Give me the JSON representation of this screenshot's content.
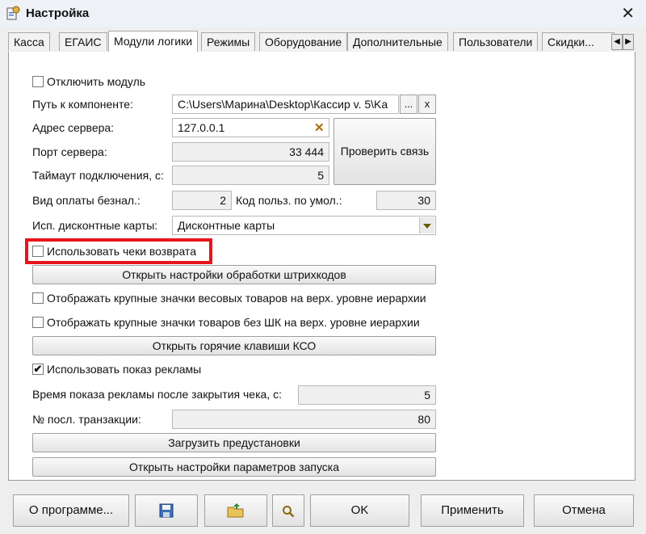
{
  "window": {
    "title": "Настройка"
  },
  "tabs": [
    "Касса",
    "ЕГАИС",
    "Модули логики",
    "Режимы",
    "Оборудование",
    "Дополнительные",
    "Пользователи",
    "Скидки..."
  ],
  "form": {
    "disable_module": {
      "label": "Отключить модуль",
      "checked": false
    },
    "component_path": {
      "label": "Путь к компоненте:",
      "value": "C:\\Users\\Марина\\Desktop\\Кассир v. 5\\Ka",
      "browse": "...",
      "clear": "x"
    },
    "server_address": {
      "label": "Адрес сервера:",
      "value": "127.0.0.1"
    },
    "server_port": {
      "label": "Порт сервера:",
      "value": "33 444"
    },
    "timeout": {
      "label": "Таймаут подключения, с:",
      "value": "5"
    },
    "check_connection": "Проверить связь",
    "cashless_payment": {
      "label": "Вид оплаты безнал.:",
      "value": "2"
    },
    "default_user_code": {
      "label": "Код польз. по умол.:",
      "value": "30"
    },
    "discount_cards": {
      "label": "Исп. дисконтные карты:",
      "value": "Дисконтные карты"
    },
    "use_return_receipts": {
      "label": "Использовать чеки возврата",
      "checked": false
    },
    "barcode_settings_button": "Открыть настройки обработки штрихкодов",
    "large_icons_weight": {
      "label": "Отображать крупные значки весовых товаров на верх. уровне иерархии",
      "checked": false
    },
    "large_icons_no_barcode": {
      "label": "Отображать крупные значки товаров без ШК на верх. уровне иерархии",
      "checked": false
    },
    "hotkeys_button": "Открыть горячие клавиши КСО",
    "use_ads": {
      "label": "Использовать показ рекламы",
      "checked": true,
      "mark": "✔"
    },
    "ad_time": {
      "label": "Время показа рекламы после закрытия чека, с:",
      "value": "5"
    },
    "last_transaction": {
      "label": "№ посл. транзакции:",
      "value": "80"
    },
    "load_presets_button": "Загрузить предустановки",
    "launch_params_button": "Открыть настройки параметров запуска"
  },
  "bottom": {
    "about": "О программе...",
    "ok": "OK",
    "apply": "Применить",
    "cancel": "Отмена"
  },
  "icons": [
    "settings-app-icon",
    "close-icon",
    "save-icon",
    "open-folder-icon",
    "search-icon",
    "clear-x-icon",
    "dropdown-arrow-icon",
    "tab-scroll-left-icon",
    "tab-scroll-right-icon"
  ],
  "colors": {
    "highlight": "#e8141c",
    "panel": "#ffffff",
    "window": "#eeeeee"
  }
}
